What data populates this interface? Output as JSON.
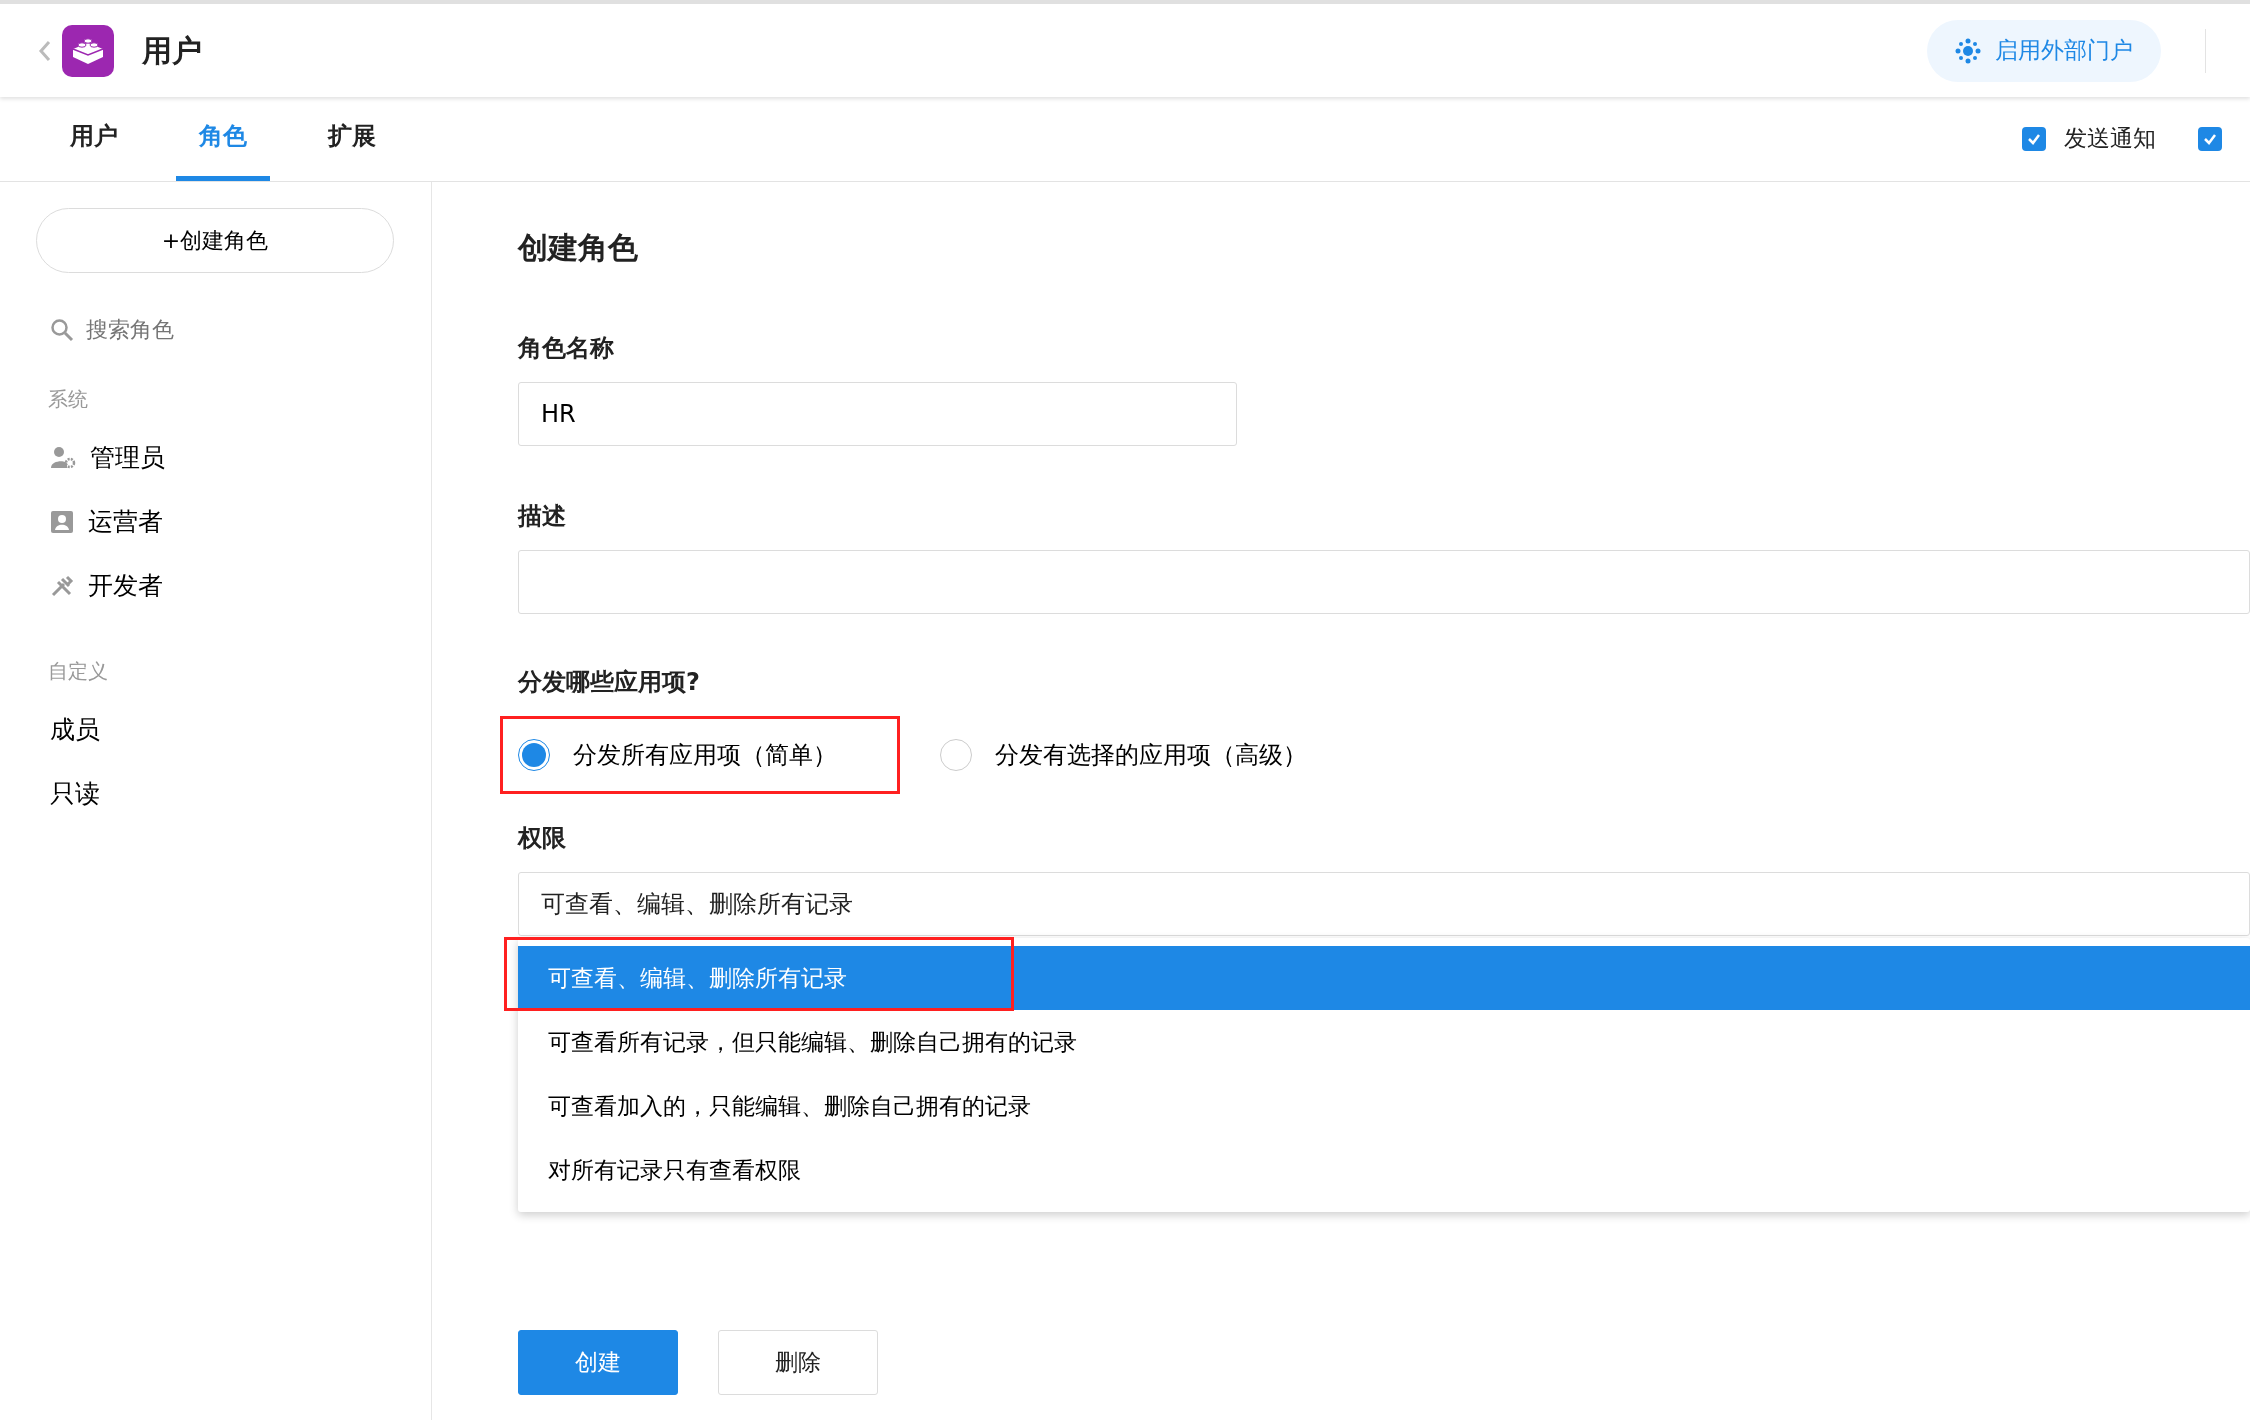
{
  "header": {
    "title": "用户",
    "portal_button": "启用外部门户"
  },
  "tabs": [
    {
      "label": "用户",
      "selected": false
    },
    {
      "label": "角色",
      "selected": true
    },
    {
      "label": "扩展",
      "selected": false
    }
  ],
  "options": [
    {
      "label": "发送通知",
      "checked": true
    },
    {
      "checked": true
    }
  ],
  "sidebar": {
    "create_button": "+创建角色",
    "search_placeholder": "搜索角色",
    "groups": [
      {
        "title": "系统",
        "items": [
          {
            "label": "管理员",
            "kind": "admin"
          },
          {
            "label": "运营者",
            "kind": "operator"
          },
          {
            "label": "开发者",
            "kind": "developer"
          }
        ]
      },
      {
        "title": "自定义",
        "items": [
          {
            "label": "成员",
            "kind": "plain"
          },
          {
            "label": "只读",
            "kind": "plain"
          }
        ]
      }
    ]
  },
  "form": {
    "title": "创建角色",
    "name_label": "角色名称",
    "name_value": "HR",
    "description_label": "描述",
    "distribute_label": "分发哪些应用项?",
    "distribute_options": [
      {
        "label": "分发所有应用项（简单）",
        "selected": true,
        "highlighted": true
      },
      {
        "label": "分发有选择的应用项（高级）",
        "selected": false,
        "highlighted": false
      }
    ],
    "permission_label": "权限",
    "permission_value": "可查看、编辑、删除所有记录",
    "permission_options": [
      {
        "label": "可查看、编辑、删除所有记录",
        "selected": true,
        "highlighted": true
      },
      {
        "label": "可查看所有记录，但只能编辑、删除自己拥有的记录",
        "selected": false,
        "highlighted": false
      },
      {
        "label": "可查看加入的，只能编辑、删除自己拥有的记录",
        "selected": false,
        "highlighted": false
      },
      {
        "label": "对所有记录只有查看权限",
        "selected": false,
        "highlighted": false
      }
    ],
    "buttons": [
      {
        "label": "创建",
        "kind": "primary"
      },
      {
        "label": "删除",
        "kind": "secondary"
      }
    ]
  }
}
